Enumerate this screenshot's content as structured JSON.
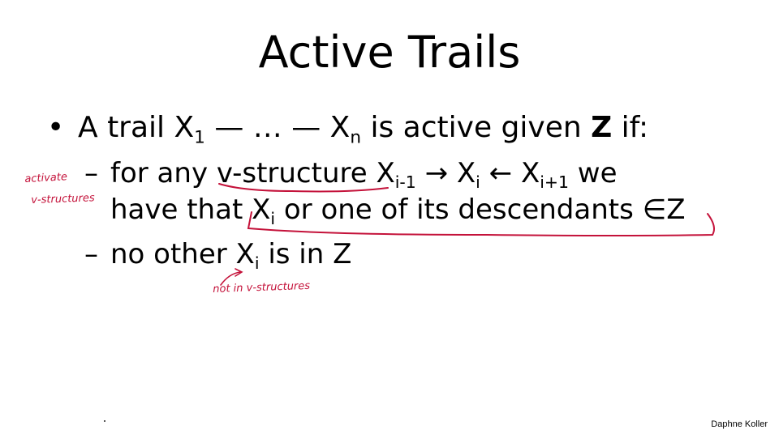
{
  "slide": {
    "title": "Active Trails",
    "line1": {
      "bullet": "•",
      "pre": "A trail X",
      "sub1": "1",
      "mid": " — … — X",
      "subn": "n",
      "post": " is active given ",
      "z": "Z",
      "end": " if:"
    },
    "line2": {
      "dash": "–",
      "pre": "for any ",
      "vstructure": "v-structure",
      "x1": " X",
      "s1": "i-1",
      "arrow1": " → X",
      "s2": "i",
      "arrow2": " ← X",
      "s3": "i+1",
      "end": "  we"
    },
    "line3": {
      "pre": "have that ",
      "x": "X",
      "s": "i",
      "post": " or one of its descendants ∈Z"
    },
    "line4": {
      "dash": "–",
      "pre": "no other X",
      "s": "i",
      "post": " is in Z"
    },
    "author": "Daphne Koller"
  },
  "annotations": {
    "note1": "activate",
    "note2": "v-structures",
    "note3": "not in v-structures",
    "ink_color": "#c4123a"
  }
}
